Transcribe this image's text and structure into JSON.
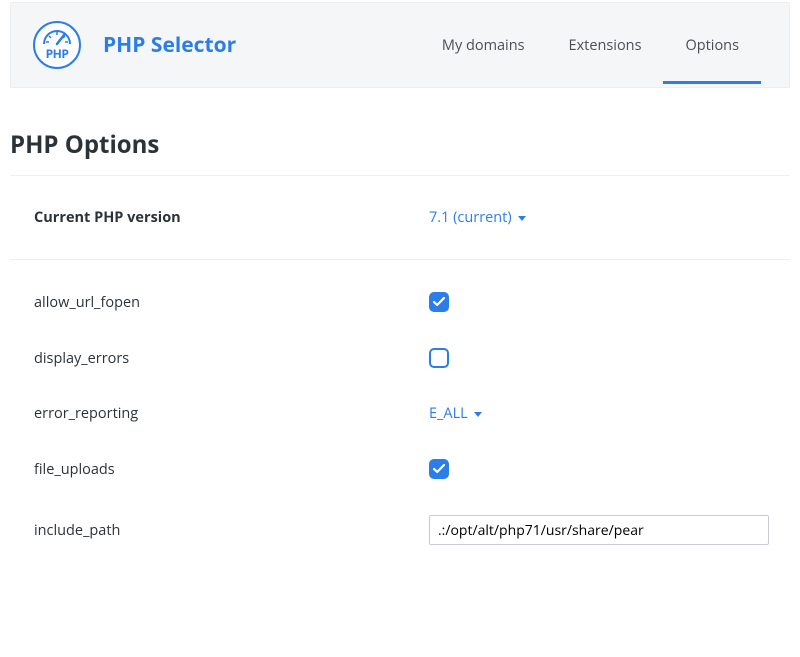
{
  "header": {
    "logo_text": "PHP",
    "brand": "PHP Selector",
    "tabs": [
      {
        "label": "My domains",
        "active": false
      },
      {
        "label": "Extensions",
        "active": false
      },
      {
        "label": "Options",
        "active": true
      }
    ]
  },
  "page_title": "PHP Options",
  "version": {
    "label": "Current PHP version",
    "value": "7.1 (current)"
  },
  "options": [
    {
      "key": "allow_url_fopen",
      "type": "checkbox",
      "checked": true
    },
    {
      "key": "display_errors",
      "type": "checkbox",
      "checked": false
    },
    {
      "key": "error_reporting",
      "type": "dropdown",
      "value": "E_ALL"
    },
    {
      "key": "file_uploads",
      "type": "checkbox",
      "checked": true
    },
    {
      "key": "include_path",
      "type": "text",
      "value": ".:/opt/alt/php71/usr/share/pear"
    }
  ]
}
